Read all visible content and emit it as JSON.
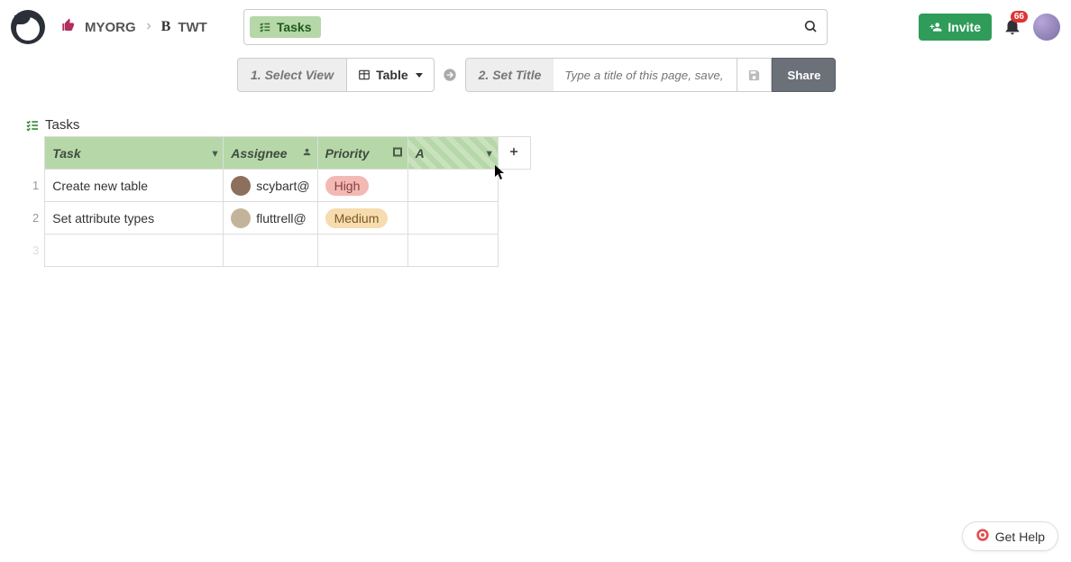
{
  "breadcrumbs": {
    "org": "MYORG",
    "project": "TWT"
  },
  "search": {
    "chip_label": "Tasks"
  },
  "topright": {
    "invite_label": "Invite",
    "notification_count": "66"
  },
  "stepbar": {
    "step1_label": "1. Select View",
    "view_dropdown_label": "Table",
    "step2_label": "2. Set Title",
    "title_placeholder": "Type a title of this page, save,",
    "share_label": "Share"
  },
  "table": {
    "title": "Tasks",
    "columns": {
      "task": "Task",
      "assignee": "Assignee",
      "priority": "Priority",
      "new": "A"
    },
    "rows": [
      {
        "num": "1",
        "task": "Create new table",
        "assignee": "scybart@",
        "priority": "High",
        "priority_class": "high"
      },
      {
        "num": "2",
        "task": "Set attribute types",
        "assignee": "fluttrell@",
        "priority": "Medium",
        "priority_class": "medium"
      }
    ]
  },
  "gethelp_label": "Get Help"
}
